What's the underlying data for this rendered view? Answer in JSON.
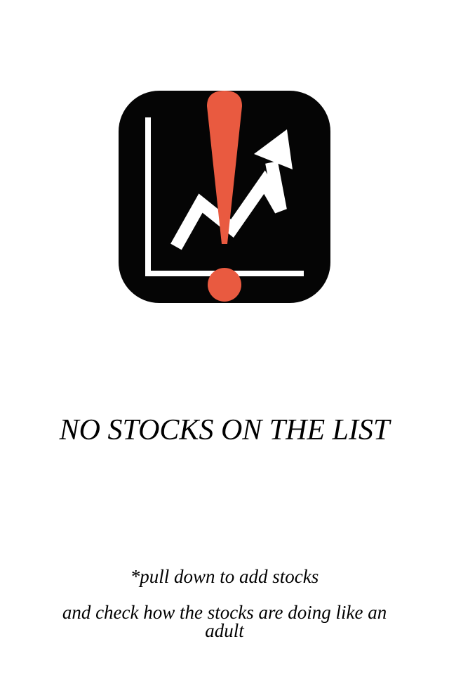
{
  "empty_state": {
    "logo_icon": "stock-alert-logo-icon",
    "title": "NO STOCKS ON THE LIST",
    "hint": "*pull down to add stocks",
    "subtext": "and check how the stocks are doing like an adult"
  },
  "colors": {
    "background": "#ffffff",
    "logo_background": "#050505",
    "accent_red": "#e95a40",
    "chart_white": "#ffffff",
    "text": "#000000"
  }
}
